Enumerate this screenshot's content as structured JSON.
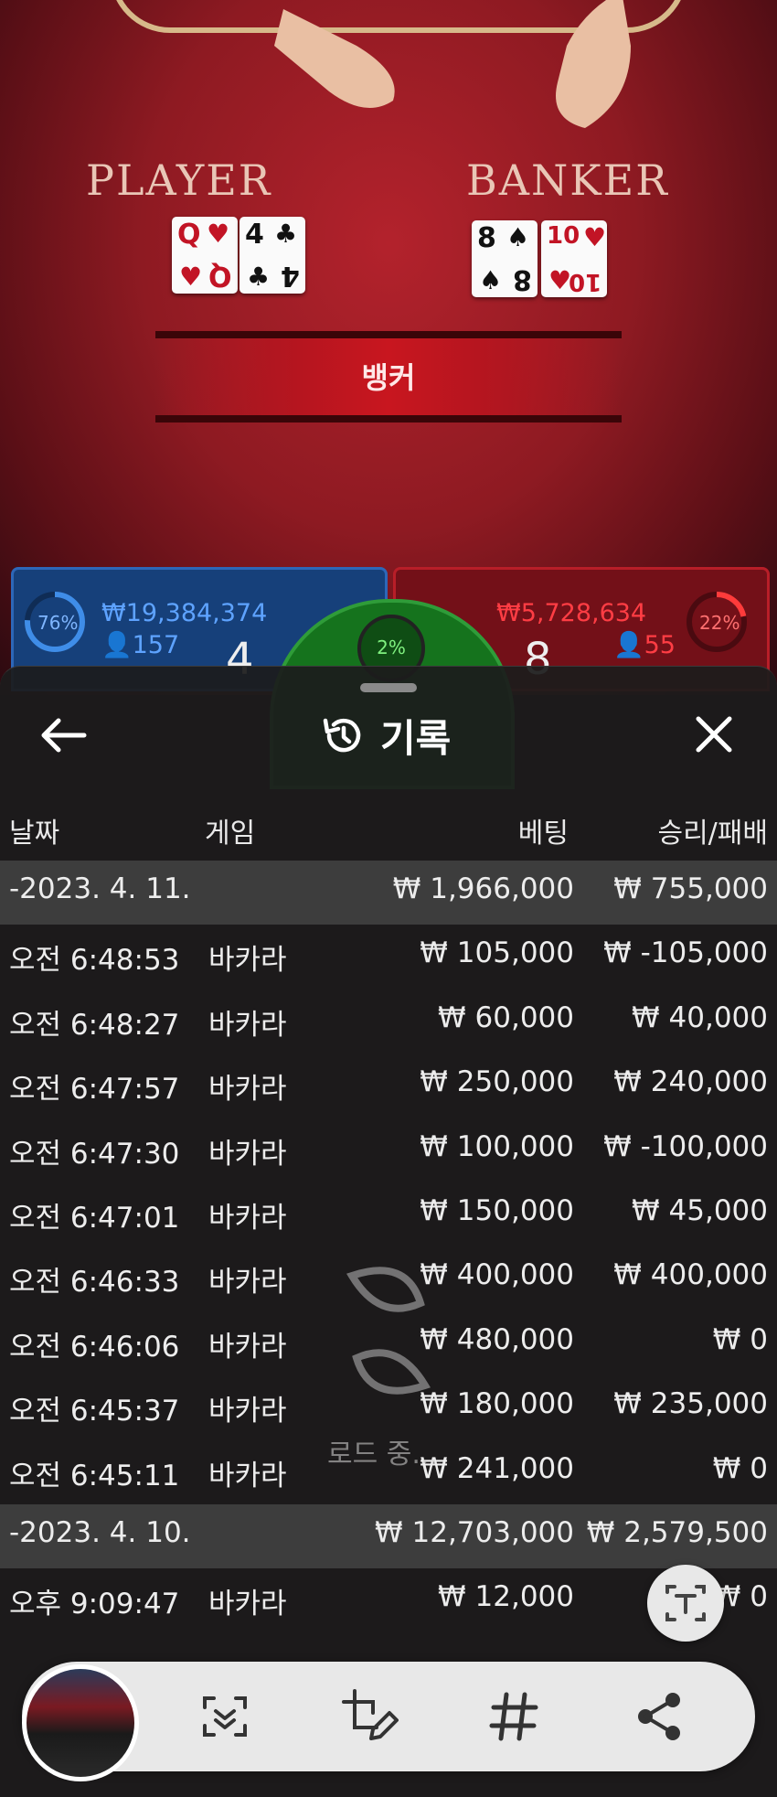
{
  "game_bg": {
    "player_title": "PLAYER",
    "banker_title": "BANKER",
    "player_cards": [
      {
        "rank": "Q",
        "suit": "♥",
        "color": "red"
      },
      {
        "rank": "4",
        "suit": "♣",
        "color": "black"
      }
    ],
    "banker_cards": [
      {
        "rank": "8",
        "suit": "♠",
        "color": "black"
      },
      {
        "rank": "10",
        "suit": "♥",
        "color": "red"
      }
    ],
    "result": "뱅커",
    "player": {
      "percent": "76%",
      "amount": "₩19,384,374",
      "users": "157",
      "score": "4"
    },
    "banker": {
      "percent": "22%",
      "amount": "₩5,728,634",
      "users": "55",
      "score": "8"
    },
    "tie": {
      "percent": "2%"
    }
  },
  "history": {
    "title": "기록",
    "headers": {
      "date": "날짜",
      "game": "게임",
      "bet": "베팅",
      "win_loss": "승리/패배"
    },
    "rows": [
      {
        "type": "date",
        "date": "-2023. 4. 11.",
        "game": "",
        "bet": "₩ 1,966,000",
        "result": "₩ 755,000"
      },
      {
        "type": "entry",
        "date": "오전 6:48:53",
        "game": "바카라",
        "bet": "₩ 105,000",
        "result": "₩ -105,000"
      },
      {
        "type": "entry",
        "date": "오전 6:48:27",
        "game": "바카라",
        "bet": "₩ 60,000",
        "result": "₩ 40,000"
      },
      {
        "type": "entry",
        "date": "오전 6:47:57",
        "game": "바카라",
        "bet": "₩ 250,000",
        "result": "₩ 240,000"
      },
      {
        "type": "entry",
        "date": "오전 6:47:30",
        "game": "바카라",
        "bet": "₩ 100,000",
        "result": "₩ -100,000"
      },
      {
        "type": "entry",
        "date": "오전 6:47:01",
        "game": "바카라",
        "bet": "₩ 150,000",
        "result": "₩ 45,000"
      },
      {
        "type": "entry",
        "date": "오전 6:46:33",
        "game": "바카라",
        "bet": "₩ 400,000",
        "result": "₩ 400,000"
      },
      {
        "type": "entry",
        "date": "오전 6:46:06",
        "game": "바카라",
        "bet": "₩ 480,000",
        "result": "₩ 0"
      },
      {
        "type": "entry",
        "date": "오전 6:45:37",
        "game": "바카라",
        "bet": "₩ 180,000",
        "result": "₩ 235,000"
      },
      {
        "type": "entry",
        "date": "오전 6:45:11",
        "game": "바카라",
        "bet": "₩ 241,000",
        "result": "₩ 0"
      },
      {
        "type": "date",
        "date": "-2023. 4. 10.",
        "game": "",
        "bet": "₩ 12,703,000",
        "result": "₩ 2,579,500"
      },
      {
        "type": "entry",
        "date": "오후 9:09:47",
        "game": "바카라",
        "bet": "₩ 12,000",
        "result": "₩ 0"
      }
    ],
    "loading_text": "로드 중..."
  },
  "toolbar": {
    "icons": [
      "smart-select-icon",
      "edit-crop-icon",
      "tag-icon",
      "share-icon"
    ],
    "text_extract": "text-extract-icon"
  },
  "colors": {
    "player_blue": "#16407a",
    "banker_red": "#731018",
    "tie_green": "#15731d",
    "sheet_bg": "#1c1c1c",
    "date_row_bg": "#3d3d3d"
  }
}
